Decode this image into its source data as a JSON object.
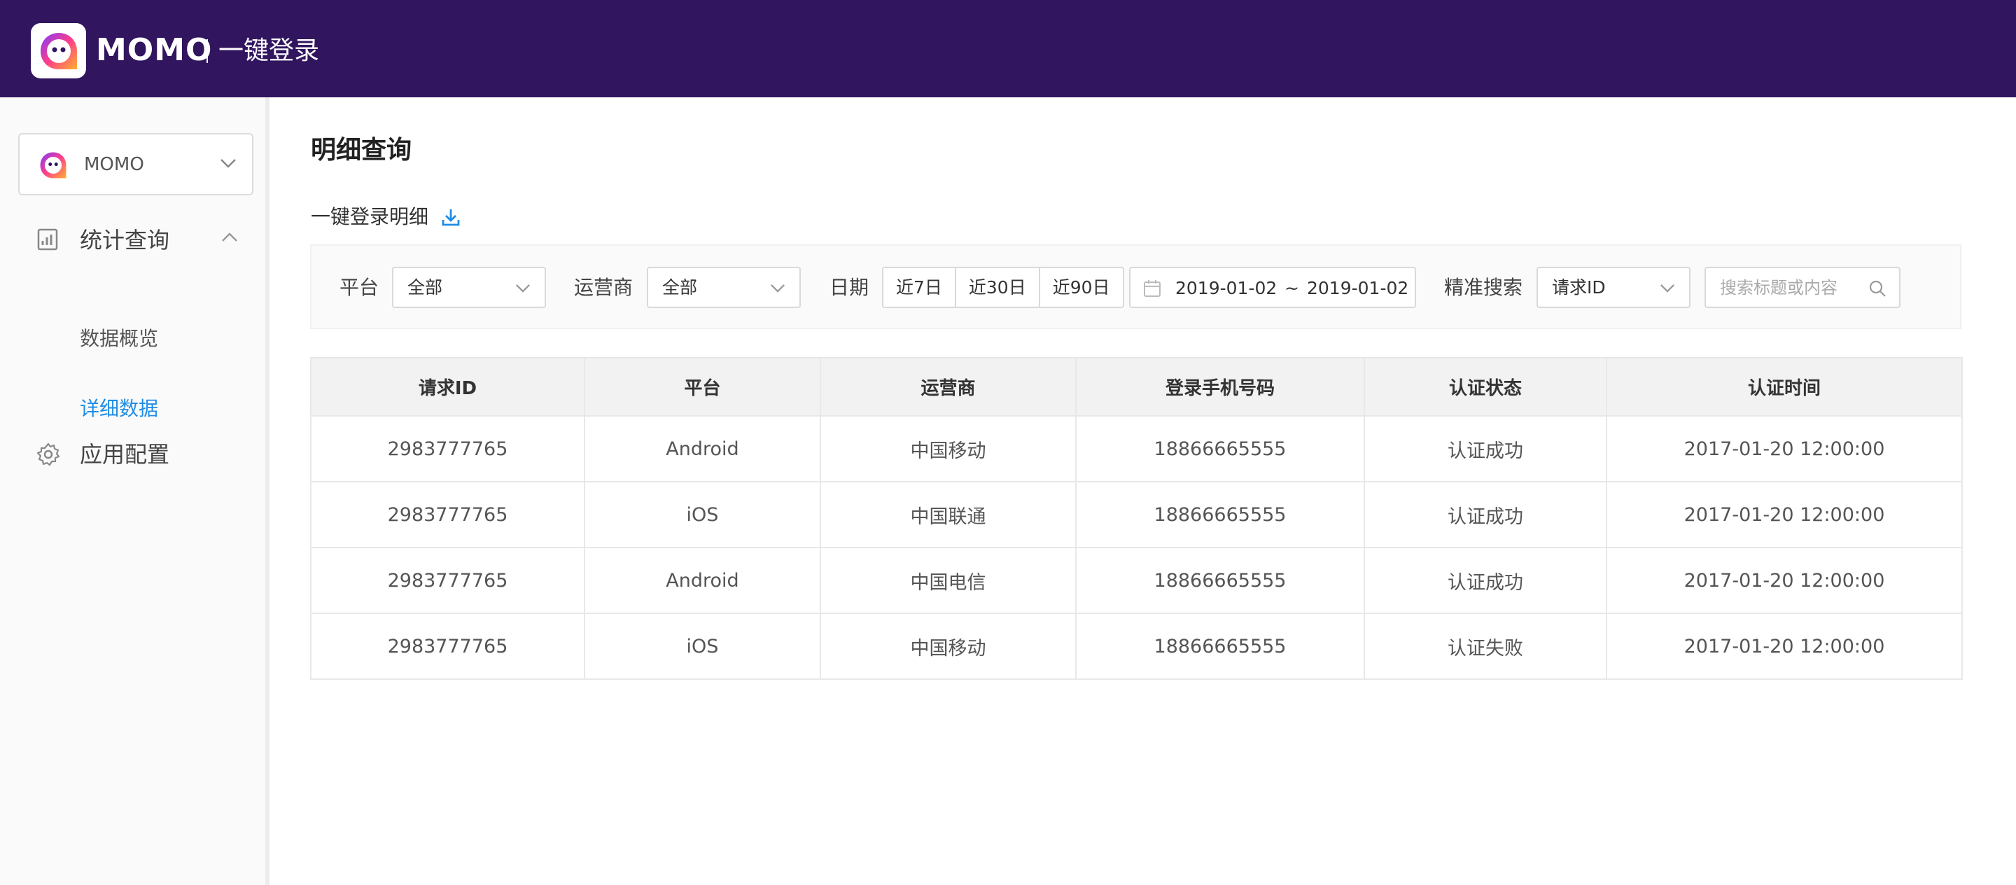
{
  "header": {
    "brand": "MOMO",
    "subtitle": "一键登录"
  },
  "sidebar": {
    "app_selector": {
      "label": "MOMO"
    },
    "nav": [
      {
        "label": "统计查询",
        "icon": "chart-doc-icon",
        "expanded": true,
        "children": [
          {
            "label": "数据概览",
            "active": false
          },
          {
            "label": "详细数据",
            "active": true
          }
        ]
      },
      {
        "label": "应用配置",
        "icon": "gear-icon",
        "expanded": false
      }
    ]
  },
  "main": {
    "page_title": "明细查询",
    "section_title": "一键登录明细",
    "filters": {
      "platform": {
        "label": "平台",
        "value": "全部"
      },
      "carrier": {
        "label": "运营商",
        "value": "全部"
      },
      "date": {
        "label": "日期",
        "quick_ranges": [
          "近7日",
          "近30日",
          "近90日"
        ],
        "start": "2019-01-02",
        "separator": "~",
        "end": "2019-01-02"
      },
      "exact_search": {
        "label": "精准搜索",
        "field": "请求ID",
        "placeholder": "搜索标题或内容"
      }
    },
    "table": {
      "columns": [
        "请求ID",
        "平台",
        "运营商",
        "登录手机号码",
        "认证状态",
        "认证时间"
      ],
      "rows": [
        [
          "2983777765",
          "Android",
          "中国移动",
          "18866665555",
          "认证成功",
          "2017-01-20 12:00:00"
        ],
        [
          "2983777765",
          "iOS",
          "中国联通",
          "18866665555",
          "认证成功",
          "2017-01-20 12:00:00"
        ],
        [
          "2983777765",
          "Android",
          "中国电信",
          "18866665555",
          "认证成功",
          "2017-01-20 12:00:00"
        ],
        [
          "2983777765",
          "iOS",
          "中国移动",
          "18866665555",
          "认证失败",
          "2017-01-20 12:00:00"
        ]
      ]
    }
  },
  "colors": {
    "header_bg": "#31155f",
    "active_link": "#1f8de6",
    "fail_status": "#f0484f"
  }
}
